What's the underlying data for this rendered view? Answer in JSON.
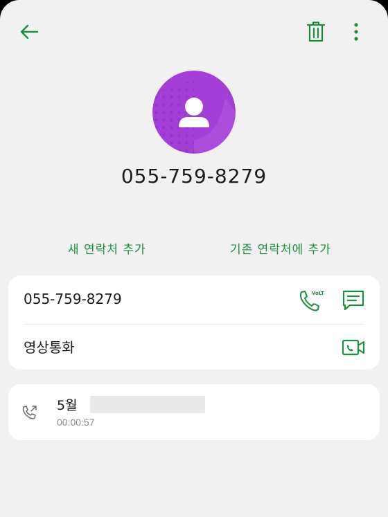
{
  "header": {
    "back_icon": "back-arrow-icon",
    "delete_icon": "trash-icon",
    "more_icon": "more-vert-icon"
  },
  "contact": {
    "avatar_icon": "person-icon",
    "avatar_color": "#a33fd6",
    "number": "055-759-8279"
  },
  "actions": {
    "new_contact": "새 연락처 추가",
    "existing_contact": "기존 연락처에 추가"
  },
  "details": {
    "phone": "055-759-8279",
    "volte_badge": "VoLTE",
    "video_call": "영상통화"
  },
  "call_log": {
    "date": "5월",
    "duration": "00:00:57"
  },
  "colors": {
    "accent_green": "#1c8f3e",
    "background": "#f1f1f1"
  }
}
